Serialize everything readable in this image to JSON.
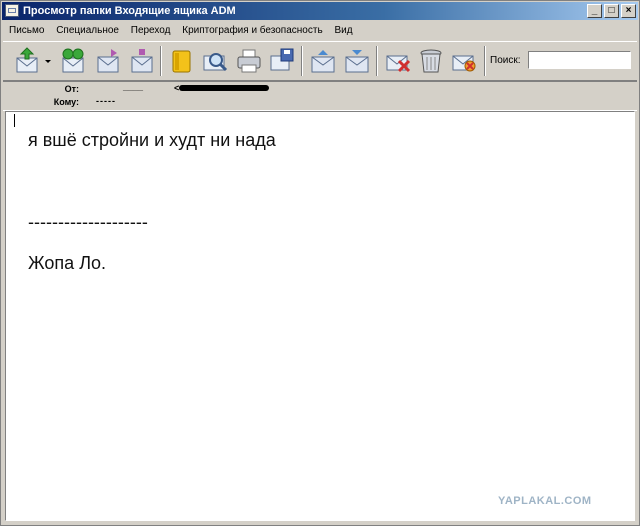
{
  "window": {
    "title": "Просмотр папки Входящие ящика ADM",
    "controls": [
      "_",
      "□",
      "×"
    ]
  },
  "menu": [
    "Письмо",
    "Специальное",
    "Переход",
    "Криптография и безопасность",
    "Вид"
  ],
  "toolbar": {
    "buttons": [
      "new-mail-icon",
      "dropdown-arrow-icon",
      "receive-mail-icon",
      "reply-icon",
      "forward-icon",
      "address-book-icon",
      "find-icon",
      "print-icon",
      "save-icon",
      "previous-message-icon",
      "next-message-icon",
      "delete-message-icon",
      "trash-icon",
      "junk-icon"
    ],
    "search_label": "Поиск:",
    "search_value": ""
  },
  "header": {
    "from_label": "От:",
    "from_value": "____",
    "from_email_prefix": "<",
    "to_label": "Кому:",
    "to_value": "-----"
  },
  "message": {
    "line1": "я вшё стройни и худт ни нада",
    "separator": "--------------------",
    "signature": "Жопа Ло."
  },
  "watermark": "YAPLAKAL.COM"
}
